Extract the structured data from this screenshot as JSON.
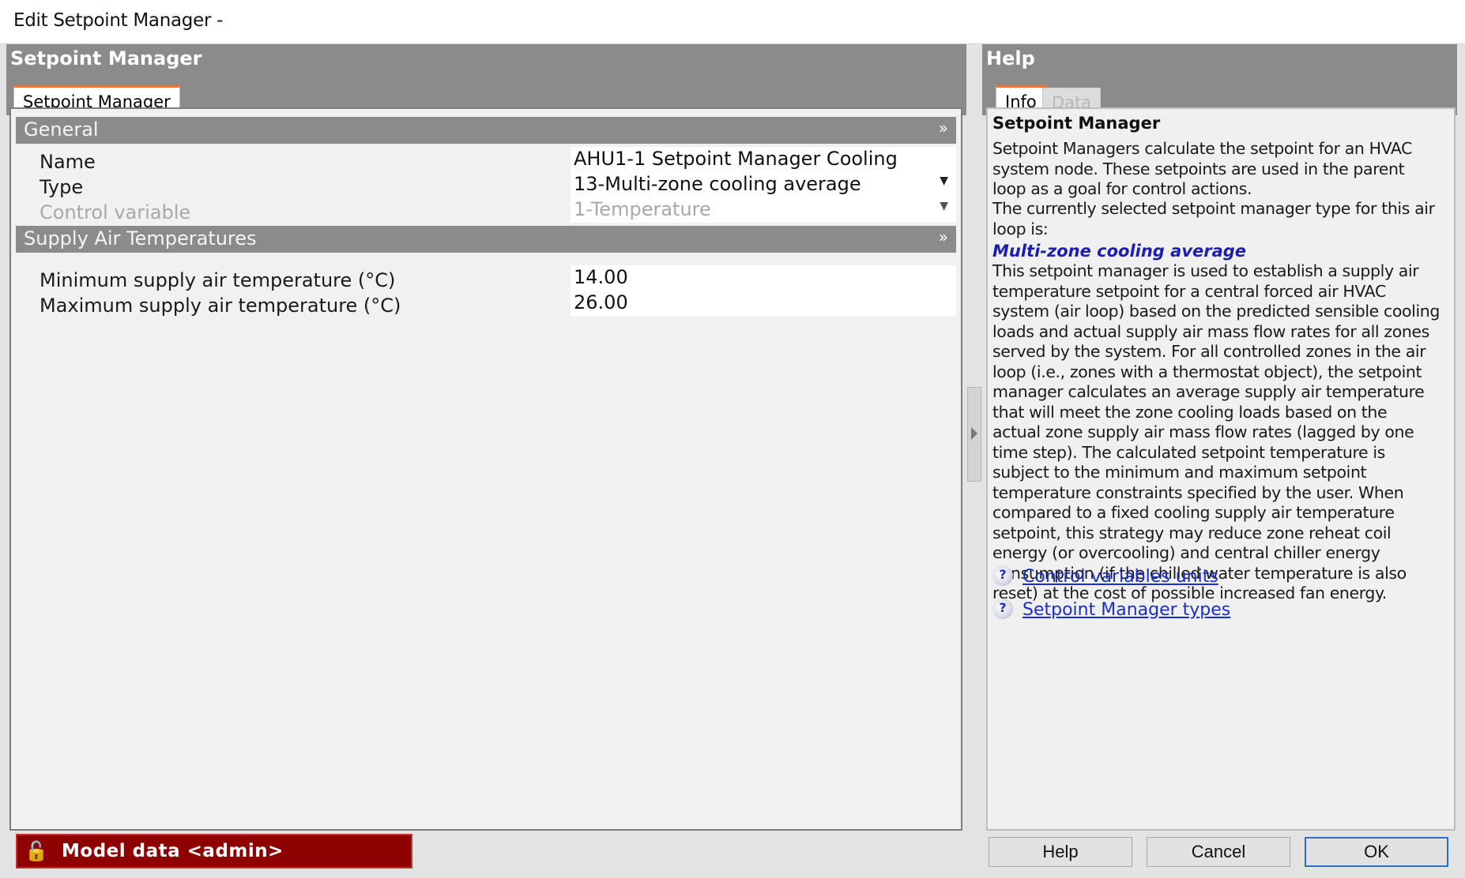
{
  "window": {
    "title": "Edit Setpoint Manager -"
  },
  "left_pane": {
    "title": "Setpoint Manager",
    "tabs": [
      {
        "label": "Setpoint Manager",
        "active": true
      }
    ],
    "sections": [
      {
        "title": "General",
        "fields": [
          {
            "label": "Name",
            "value": "AHU1-1 Setpoint Manager Cooling",
            "type": "text",
            "enabled": true
          },
          {
            "label": "Type",
            "value": "13-Multi-zone cooling average",
            "type": "dropdown",
            "enabled": true
          },
          {
            "label": "Control variable",
            "value": "1-Temperature",
            "type": "dropdown",
            "enabled": false
          }
        ]
      },
      {
        "title": "Supply Air Temperatures",
        "fields": [
          {
            "label": "Minimum supply air temperature (°C)",
            "value": "14.00",
            "type": "number",
            "enabled": true
          },
          {
            "label": "Maximum supply air temperature (°C)",
            "value": "26.00",
            "type": "number",
            "enabled": true
          }
        ]
      }
    ]
  },
  "right_pane": {
    "title": "Help",
    "tabs": [
      {
        "label": "Info",
        "active": true
      },
      {
        "label": "Data",
        "active": false
      }
    ],
    "help_title": "Setpoint Manager",
    "para1": "Setpoint Managers calculate the setpoint for an HVAC system node. These setpoints are used in the parent loop as a goal for control actions.",
    "para2": "The currently selected setpoint manager type for this air loop is:",
    "type_name": "Multi-zone cooling average",
    "type_description": "This setpoint manager is used to establish a supply air temperature setpoint for a central forced air HVAC system (air loop) based on the predicted sensible cooling loads and actual supply air mass flow rates for all zones served by the system. For all controlled zones in the air loop (i.e., zones with a thermostat object), the setpoint manager calculates an average supply air temperature that will meet the zone cooling loads based on the actual zone supply air mass flow rates (lagged by one time step). The calculated setpoint temperature is subject to the minimum and maximum setpoint temperature constraints specified by the user. When compared to a fixed cooling supply air temperature setpoint, this strategy may reduce zone reheat coil energy (or overcooling) and central chiller energy consumption (if the chilled water temperature is also reset) at the cost of possible increased fan energy.",
    "links": [
      {
        "label": "Control variables units",
        "icon": "help-question-icon"
      },
      {
        "label": "Setpoint Manager types",
        "icon": "help-question-icon"
      }
    ]
  },
  "footer": {
    "model_badge": "Model data <admin>",
    "model_badge_icon": "lock-open-icon",
    "buttons": {
      "help": "Help",
      "cancel": "Cancel",
      "ok": "OK"
    }
  },
  "colors": {
    "header_gray": "#8b8b8b",
    "tab_accent": "#e8743b",
    "badge_red": "#8f0000",
    "link_blue": "#1a2fc8",
    "subtitle_blue": "#1d1db0"
  }
}
